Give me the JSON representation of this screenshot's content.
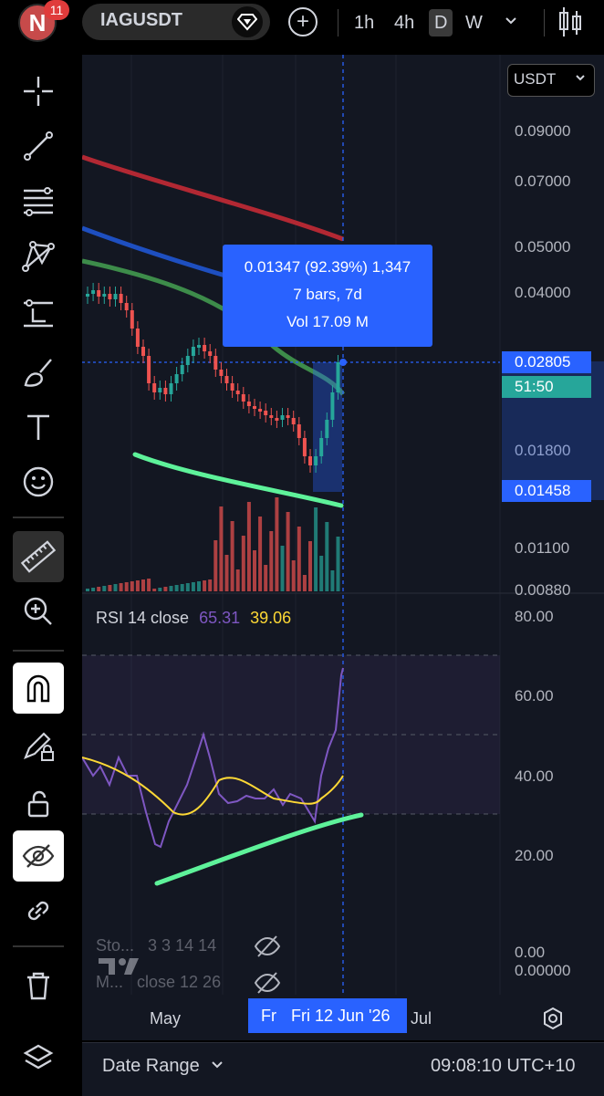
{
  "topbar": {
    "notification_count": "11",
    "avatar_letter": "N",
    "symbol": "IAGUSDT",
    "add_label": "+",
    "timeframes": [
      "1h",
      "4h",
      "D",
      "W"
    ],
    "selected_timeframe": "D"
  },
  "chart": {
    "currency": "USDT",
    "price_labels": [
      "0.09000",
      "0.07000",
      "0.05000",
      "0.04000",
      "0.02800",
      "0.01800",
      "0.01100",
      "0.00880"
    ],
    "current_price": "0.02805",
    "countdown": "51:50",
    "measure_low": "0.01458",
    "measure": {
      "line1": "0.01347 (92.39%) 1,347",
      "line2": "7 bars, 7d",
      "line3": "Vol 17.09 M"
    },
    "rsi": {
      "label": "RSI 14 close",
      "value1": "65.31",
      "value2": "39.06",
      "scale": [
        "80.00",
        "60.00",
        "40.00",
        "20.00",
        "0.00"
      ]
    },
    "indicators": [
      {
        "name": "Sto...",
        "params": "3 3 14 14"
      },
      {
        "name": "M...",
        "params": "close 12 26"
      }
    ],
    "extra_scale": "0.00000",
    "date_labels": {
      "may": "May",
      "jul": "Jul",
      "fr": "Fr",
      "crosshair_date": "Fri 12 Jun '26"
    },
    "colors": {
      "up": "#26a69a",
      "down": "#ef5350",
      "blue": "#2962ff",
      "ma_red": "#b22833",
      "ma_blue": "#1e4fc0",
      "ma_green": "#3d8c4a",
      "rsi": "#7e57c2",
      "rsi_ma": "#fdd835",
      "drawn_line": "#5ef29a"
    }
  },
  "bottombar": {
    "date_range": "Date Range",
    "time": "09:08:10 UTC+10"
  },
  "tools": [
    "crosshair-icon",
    "trendline-icon",
    "fib-icon",
    "pattern-icon",
    "prediction-icon",
    "brush-icon",
    "text-icon",
    "emoji-icon",
    "ruler-icon",
    "zoom-icon",
    "magnet-icon",
    "lock-drawing-icon",
    "unlock-icon",
    "hide-icon",
    "link-icon",
    "trash-icon",
    "layers-icon"
  ]
}
